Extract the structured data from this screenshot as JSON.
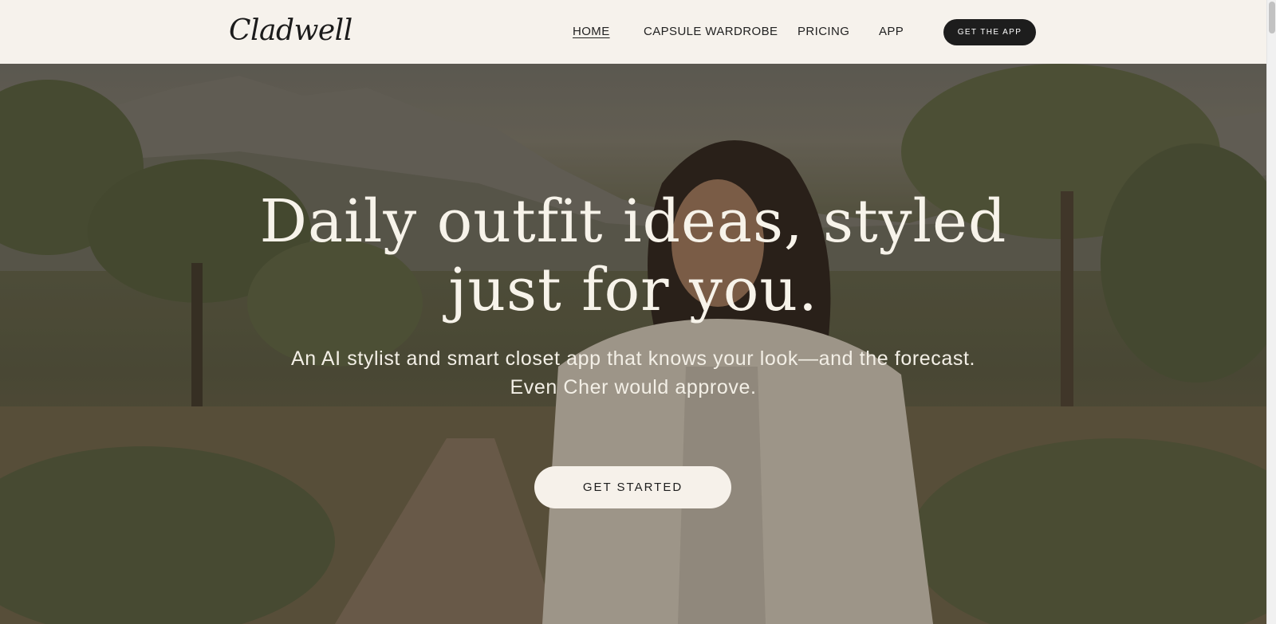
{
  "header": {
    "logo": "Cladwell",
    "nav": [
      {
        "label": "HOME",
        "active": true
      },
      {
        "label": "CAPSULE WARDROBE",
        "active": false
      },
      {
        "label": "PRICING",
        "active": false
      },
      {
        "label": "APP",
        "active": false
      }
    ],
    "cta_label": "GET THE APP"
  },
  "hero": {
    "headline_line1": "Daily outfit ideas, styled",
    "headline_line2": "just for you.",
    "subtitle_line1": "An AI stylist and smart closet app that knows your look—and the forecast.",
    "subtitle_line2": "Even Cher would approve.",
    "cta_label": "GET STARTED",
    "background_image": "woman-on-trail-photo"
  },
  "colors": {
    "header_bg": "#f6f2ec",
    "dark_button": "#1d1d1d",
    "light_button": "#f6f1ea",
    "hero_text": "#f7f3ea"
  }
}
